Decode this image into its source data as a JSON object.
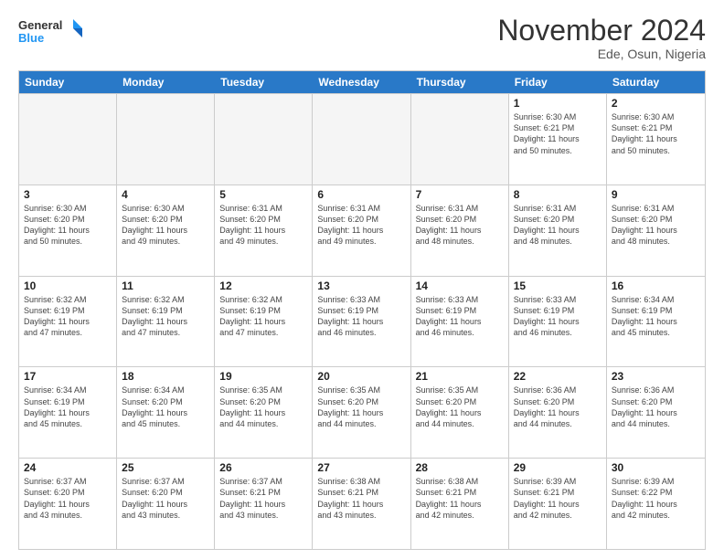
{
  "logo": {
    "line1": "General",
    "line2": "Blue"
  },
  "title": "November 2024",
  "location": "Ede, Osun, Nigeria",
  "days_header": [
    "Sunday",
    "Monday",
    "Tuesday",
    "Wednesday",
    "Thursday",
    "Friday",
    "Saturday"
  ],
  "rows": [
    [
      {
        "day": "",
        "info": "",
        "empty": true
      },
      {
        "day": "",
        "info": "",
        "empty": true
      },
      {
        "day": "",
        "info": "",
        "empty": true
      },
      {
        "day": "",
        "info": "",
        "empty": true
      },
      {
        "day": "",
        "info": "",
        "empty": true
      },
      {
        "day": "1",
        "info": "Sunrise: 6:30 AM\nSunset: 6:21 PM\nDaylight: 11 hours\nand 50 minutes."
      },
      {
        "day": "2",
        "info": "Sunrise: 6:30 AM\nSunset: 6:21 PM\nDaylight: 11 hours\nand 50 minutes."
      }
    ],
    [
      {
        "day": "3",
        "info": "Sunrise: 6:30 AM\nSunset: 6:20 PM\nDaylight: 11 hours\nand 50 minutes."
      },
      {
        "day": "4",
        "info": "Sunrise: 6:30 AM\nSunset: 6:20 PM\nDaylight: 11 hours\nand 49 minutes."
      },
      {
        "day": "5",
        "info": "Sunrise: 6:31 AM\nSunset: 6:20 PM\nDaylight: 11 hours\nand 49 minutes."
      },
      {
        "day": "6",
        "info": "Sunrise: 6:31 AM\nSunset: 6:20 PM\nDaylight: 11 hours\nand 49 minutes."
      },
      {
        "day": "7",
        "info": "Sunrise: 6:31 AM\nSunset: 6:20 PM\nDaylight: 11 hours\nand 48 minutes."
      },
      {
        "day": "8",
        "info": "Sunrise: 6:31 AM\nSunset: 6:20 PM\nDaylight: 11 hours\nand 48 minutes."
      },
      {
        "day": "9",
        "info": "Sunrise: 6:31 AM\nSunset: 6:20 PM\nDaylight: 11 hours\nand 48 minutes."
      }
    ],
    [
      {
        "day": "10",
        "info": "Sunrise: 6:32 AM\nSunset: 6:19 PM\nDaylight: 11 hours\nand 47 minutes."
      },
      {
        "day": "11",
        "info": "Sunrise: 6:32 AM\nSunset: 6:19 PM\nDaylight: 11 hours\nand 47 minutes."
      },
      {
        "day": "12",
        "info": "Sunrise: 6:32 AM\nSunset: 6:19 PM\nDaylight: 11 hours\nand 47 minutes."
      },
      {
        "day": "13",
        "info": "Sunrise: 6:33 AM\nSunset: 6:19 PM\nDaylight: 11 hours\nand 46 minutes."
      },
      {
        "day": "14",
        "info": "Sunrise: 6:33 AM\nSunset: 6:19 PM\nDaylight: 11 hours\nand 46 minutes."
      },
      {
        "day": "15",
        "info": "Sunrise: 6:33 AM\nSunset: 6:19 PM\nDaylight: 11 hours\nand 46 minutes."
      },
      {
        "day": "16",
        "info": "Sunrise: 6:34 AM\nSunset: 6:19 PM\nDaylight: 11 hours\nand 45 minutes."
      }
    ],
    [
      {
        "day": "17",
        "info": "Sunrise: 6:34 AM\nSunset: 6:19 PM\nDaylight: 11 hours\nand 45 minutes."
      },
      {
        "day": "18",
        "info": "Sunrise: 6:34 AM\nSunset: 6:20 PM\nDaylight: 11 hours\nand 45 minutes."
      },
      {
        "day": "19",
        "info": "Sunrise: 6:35 AM\nSunset: 6:20 PM\nDaylight: 11 hours\nand 44 minutes."
      },
      {
        "day": "20",
        "info": "Sunrise: 6:35 AM\nSunset: 6:20 PM\nDaylight: 11 hours\nand 44 minutes."
      },
      {
        "day": "21",
        "info": "Sunrise: 6:35 AM\nSunset: 6:20 PM\nDaylight: 11 hours\nand 44 minutes."
      },
      {
        "day": "22",
        "info": "Sunrise: 6:36 AM\nSunset: 6:20 PM\nDaylight: 11 hours\nand 44 minutes."
      },
      {
        "day": "23",
        "info": "Sunrise: 6:36 AM\nSunset: 6:20 PM\nDaylight: 11 hours\nand 44 minutes."
      }
    ],
    [
      {
        "day": "24",
        "info": "Sunrise: 6:37 AM\nSunset: 6:20 PM\nDaylight: 11 hours\nand 43 minutes."
      },
      {
        "day": "25",
        "info": "Sunrise: 6:37 AM\nSunset: 6:20 PM\nDaylight: 11 hours\nand 43 minutes."
      },
      {
        "day": "26",
        "info": "Sunrise: 6:37 AM\nSunset: 6:21 PM\nDaylight: 11 hours\nand 43 minutes."
      },
      {
        "day": "27",
        "info": "Sunrise: 6:38 AM\nSunset: 6:21 PM\nDaylight: 11 hours\nand 43 minutes."
      },
      {
        "day": "28",
        "info": "Sunrise: 6:38 AM\nSunset: 6:21 PM\nDaylight: 11 hours\nand 42 minutes."
      },
      {
        "day": "29",
        "info": "Sunrise: 6:39 AM\nSunset: 6:21 PM\nDaylight: 11 hours\nand 42 minutes."
      },
      {
        "day": "30",
        "info": "Sunrise: 6:39 AM\nSunset: 6:22 PM\nDaylight: 11 hours\nand 42 minutes."
      }
    ]
  ]
}
